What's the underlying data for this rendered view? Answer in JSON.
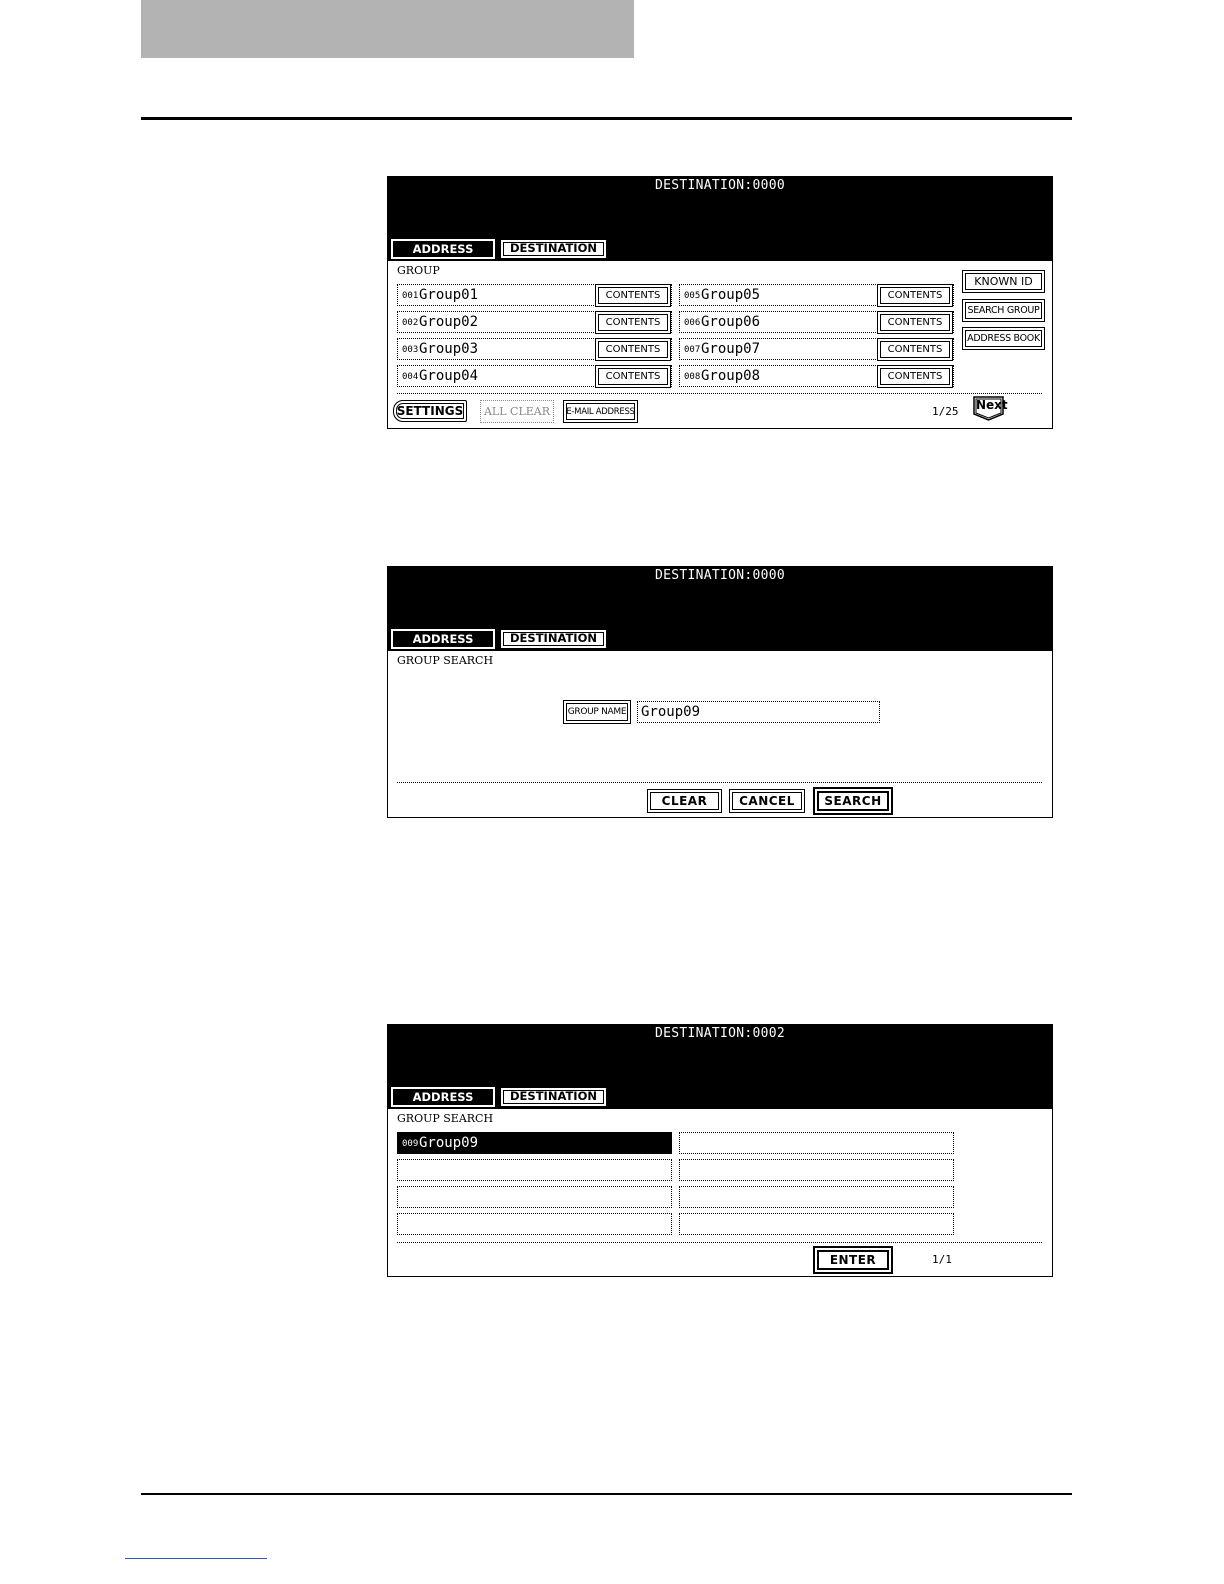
{
  "screens": [
    {
      "destination_label": "DESTINATION:0000",
      "tabs": {
        "address": "ADDRESS",
        "destination": "DESTINATION"
      },
      "section": "GROUP",
      "groups": [
        {
          "num": "001",
          "name": "Group01"
        },
        {
          "num": "002",
          "name": "Group02"
        },
        {
          "num": "003",
          "name": "Group03"
        },
        {
          "num": "004",
          "name": "Group04"
        },
        {
          "num": "005",
          "name": "Group05"
        },
        {
          "num": "006",
          "name": "Group06"
        },
        {
          "num": "007",
          "name": "Group07"
        },
        {
          "num": "008",
          "name": "Group08"
        }
      ],
      "contents_label": "CONTENTS",
      "side_buttons": {
        "known_id": "KNOWN ID",
        "search_group": "SEARCH GROUP",
        "address_book": "ADDRESS BOOK"
      },
      "bottom": {
        "settings": "SETTINGS",
        "all_clear": "ALL CLEAR",
        "email_address": "E-MAIL ADDRESS",
        "page": "1/25",
        "next": "Next"
      }
    },
    {
      "destination_label": "DESTINATION:0000",
      "tabs": {
        "address": "ADDRESS",
        "destination": "DESTINATION"
      },
      "section": "GROUP SEARCH",
      "group_name_button": "GROUP NAME",
      "group_name_value": "Group09",
      "buttons": {
        "clear": "CLEAR",
        "cancel": "CANCEL",
        "search": "SEARCH"
      }
    },
    {
      "destination_label": "DESTINATION:0002",
      "tabs": {
        "address": "ADDRESS",
        "destination": "DESTINATION"
      },
      "section": "GROUP SEARCH",
      "results": [
        {
          "num": "009",
          "name": "Group09"
        }
      ],
      "enter": "ENTER",
      "page": "1/1"
    }
  ]
}
